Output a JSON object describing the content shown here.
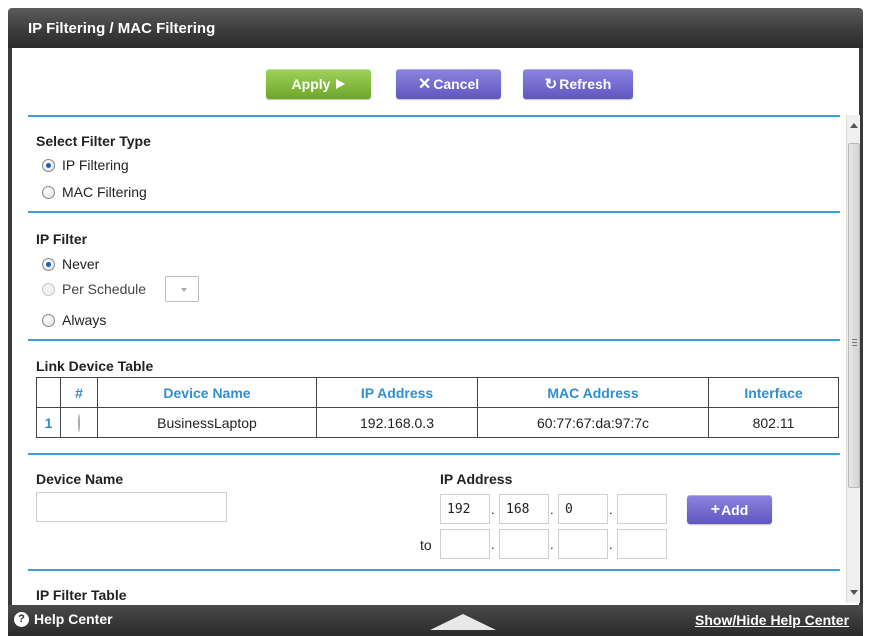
{
  "window": {
    "title": "IP Filtering / MAC Filtering"
  },
  "toolbar": {
    "apply": "Apply",
    "cancel": "Cancel",
    "refresh": "Refresh"
  },
  "filter_type": {
    "heading": "Select Filter Type",
    "options": [
      {
        "label": "IP Filtering",
        "selected": true
      },
      {
        "label": "MAC Filtering",
        "selected": false
      }
    ]
  },
  "ip_filter": {
    "heading": "IP Filter",
    "options": [
      {
        "label": "Never",
        "selected": true
      },
      {
        "label": "Per Schedule",
        "selected": false,
        "enabled": false
      },
      {
        "label": "Always",
        "selected": false
      }
    ]
  },
  "link_device_table": {
    "heading": "Link Device Table",
    "columns": [
      "#",
      "Device Name",
      "IP Address",
      "MAC Address",
      "Interface"
    ],
    "rows": [
      {
        "index": "1",
        "device_name": "BusinessLaptop",
        "ip_address": "192.168.0.3",
        "mac_address": "60:77:67:da:97:7c",
        "interface": "802.11"
      }
    ]
  },
  "add_form": {
    "device_name_label": "Device Name",
    "device_name_value": "",
    "ip_address_label": "IP Address",
    "ip_from": [
      "192",
      "168",
      "0",
      ""
    ],
    "to_label": "to",
    "ip_to": [
      "",
      "",
      "",
      ""
    ],
    "add_label": "Add"
  },
  "ip_filter_table": {
    "heading": "IP Filter Table"
  },
  "footer": {
    "help_center": "Help Center",
    "show_hide": "Show/Hide Help Center"
  },
  "colors": {
    "accent_rule": "#3aa0d8",
    "apply_green": "#7fb83a",
    "purple": "#6e66cc",
    "header_dark": "#3a3a3a"
  }
}
